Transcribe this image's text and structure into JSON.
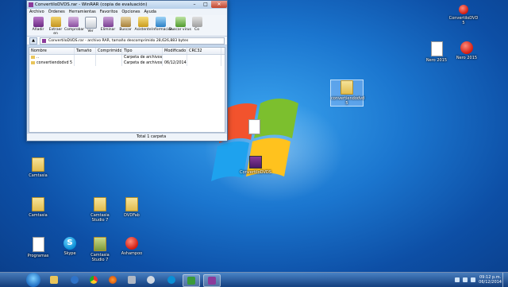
{
  "winrar": {
    "title": "ConvertiloDVDS.rar - WinRAR (copia de evaluación)",
    "menu": [
      "Archivo",
      "Órdenes",
      "Herramientas",
      "Favoritos",
      "Opciones",
      "Ayuda"
    ],
    "toolbar": [
      "Añadir",
      "Extraer en",
      "Comprobar",
      "Ver",
      "Eliminar",
      "Buscar",
      "Asistente",
      "Información",
      "Buscar virus",
      "Co"
    ],
    "address": "ConvertiloDVDS.rar - archivo RAR, tamaño descomprimido 28,626,883 bytes",
    "columns": [
      "Nombre",
      "Tamaño",
      "Comprimido",
      "Tipo",
      "Modificado",
      "CRC32"
    ],
    "rows": [
      {
        "name": "..",
        "size": "",
        "packed": "",
        "type": "Carpeta de archivos",
        "modified": "",
        "crc": ""
      },
      {
        "name": "convertiendodvd 5",
        "size": "",
        "packed": "",
        "type": "Carpeta de archivos",
        "modified": "06/12/2014 07:...",
        "crc": ""
      }
    ],
    "status": "Total 1 carpeta"
  },
  "desktop": {
    "icons": [
      {
        "label": "ConvertiloDVD 5",
        "type": "app"
      },
      {
        "label": "Nero 2015",
        "type": "file"
      },
      {
        "label": "Nero 2015",
        "type": "app"
      },
      {
        "label": "convertiendodvd 5",
        "type": "folder"
      },
      {
        "label": "ConvertiloDVDS",
        "type": "rar"
      },
      {
        "label": "",
        "type": "file"
      },
      {
        "label": "Camtasia",
        "type": "folder"
      },
      {
        "label": "Camtasia",
        "type": "folder"
      },
      {
        "label": "Camtasia Studio 7",
        "type": "folder"
      },
      {
        "label": "DVDFab",
        "type": "folder"
      },
      {
        "label": "Programas",
        "type": "file"
      },
      {
        "label": "Skype",
        "type": "app"
      },
      {
        "label": "Camtasia Studio 7",
        "type": "folder"
      },
      {
        "label": "Ashampoo",
        "type": "app"
      }
    ]
  },
  "taskbar": {
    "time": "09:12 p.m.",
    "date": "06/12/2014"
  }
}
